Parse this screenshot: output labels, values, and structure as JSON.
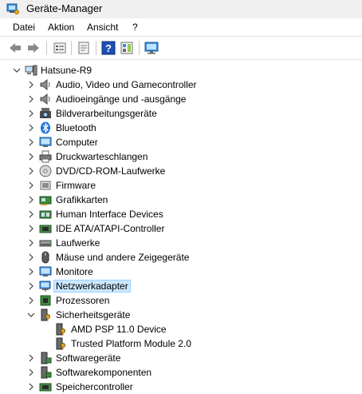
{
  "window": {
    "title": "Geräte-Manager"
  },
  "menu": [
    "Datei",
    "Aktion",
    "Ansicht",
    "?"
  ],
  "toolbar": [
    "back-icon",
    "forward-icon",
    "devices-view-icon",
    "properties-icon",
    "help-icon",
    "driver-view-icon",
    "monitor-icon"
  ],
  "tree": {
    "root": "Hatsune-R9",
    "categories": [
      "Audio, Video und Gamecontroller",
      "Audioeingänge und -ausgänge",
      "Bildverarbeitungsgeräte",
      "Bluetooth",
      "Computer",
      "Druckwarteschlangen",
      "DVD/CD-ROM-Laufwerke",
      "Firmware",
      "Grafikkarten",
      "Human Interface Devices",
      "IDE ATA/ATAPI-Controller",
      "Laufwerke",
      "Mäuse und andere Zeigegeräte",
      "Monitore",
      "Netzwerkadapter",
      "Prozessoren",
      "Sicherheitsgeräte",
      "Softwaregeräte",
      "Softwarekomponenten",
      "Speichercontroller"
    ],
    "selected": "Netzwerkadapter",
    "expanded": "Sicherheitsgeräte",
    "children": [
      "AMD PSP 11.0 Device",
      "Trusted Platform Module 2.0"
    ]
  },
  "colors": {
    "selection": "#cce8ff",
    "accent": "#1e90ff"
  }
}
